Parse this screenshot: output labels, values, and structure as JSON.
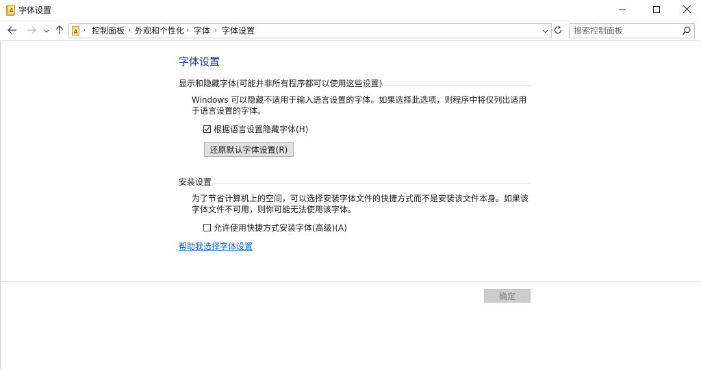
{
  "window": {
    "title": "字体设置"
  },
  "address": {
    "crumbs": [
      "控制面板",
      "外观和个性化",
      "字体",
      "字体设置"
    ]
  },
  "search": {
    "placeholder": "搜索控制面板"
  },
  "page": {
    "title": "字体设置"
  },
  "display_group": {
    "heading": "显示和隐藏字体(可能并非所有程序都可以使用这些设置)",
    "description": "Windows 可以隐藏不适用于输入语言设置的字体。如果选择此选项，则程序中将仅列出适用于语言设置的字体。",
    "checkbox_label": "根据语言设置隐藏字体(H)",
    "checkbox_checked": true,
    "restore_button": "还原默认字体设置(R)"
  },
  "install_group": {
    "heading": "安装设置",
    "description": "为了节省计算机上的空间，可以选择安装字体文件的快捷方式而不是安装该文件本身。如果该字体文件不可用，则你可能无法使用该字体。",
    "checkbox_label": "允许使用快捷方式安装字体(高级)(A)",
    "checkbox_checked": false
  },
  "help_link": "帮助我选择字体设置",
  "footer": {
    "ok_button": "确定"
  },
  "icons": {
    "app": "folder-font-icon",
    "back": "back-arrow-icon",
    "forward": "forward-arrow-icon",
    "recent": "chevron-down-icon",
    "up": "up-arrow-icon",
    "refresh": "refresh-icon",
    "search": "search-icon"
  },
  "colors": {
    "title_blue": "#1e3287",
    "link_blue": "#0066cc"
  }
}
